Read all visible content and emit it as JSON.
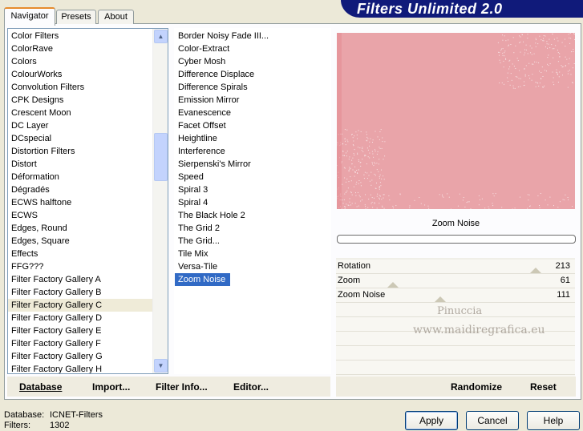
{
  "title": "Filters Unlimited 2.0",
  "tabs": [
    {
      "label": "Navigator"
    },
    {
      "label": "Presets"
    },
    {
      "label": "About"
    }
  ],
  "categories": [
    "Color Filters",
    "ColorRave",
    "Colors",
    "ColourWorks",
    "Convolution Filters",
    "CPK Designs",
    "Crescent Moon",
    "DC Layer",
    "DCspecial",
    "Distortion Filters",
    "Distort",
    "Déformation",
    "Dégradés",
    "ECWS halftone",
    "ECWS",
    "Edges, Round",
    "Edges, Square",
    "Effects",
    "FFG???",
    "Filter Factory Gallery A",
    "Filter Factory Gallery B",
    "Filter Factory Gallery C",
    "Filter Factory Gallery D",
    "Filter Factory Gallery E",
    "Filter Factory Gallery F",
    "Filter Factory Gallery G",
    "Filter Factory Gallery H"
  ],
  "selected_category": "Filter Factory Gallery C",
  "filters": [
    "Border Noisy Fade III...",
    "Color-Extract",
    "Cyber Mosh",
    "Difference Displace",
    "Difference Spirals",
    "Emission Mirror",
    "Evanescence",
    "Facet Offset",
    "Heightline",
    "Interference",
    "Sierpenski's Mirror",
    "Speed",
    "Spiral 3",
    "Spiral 4",
    "The Black Hole 2",
    "The Grid 2",
    "The Grid...",
    "Tile Mix",
    "Versa-Tile",
    "Zoom Noise"
  ],
  "selected_filter": "Zoom Noise",
  "preview": {
    "color": "#e9a4a9"
  },
  "filter_name": "Zoom Noise",
  "params": [
    {
      "name": "Rotation",
      "value": "213",
      "level": 0.835
    },
    {
      "name": "Zoom",
      "value": "61",
      "level": 0.239
    },
    {
      "name": "Zoom Noise",
      "value": "111",
      "level": 0.435
    }
  ],
  "watermark": {
    "line1": "Pinuccia",
    "line2": "www.maidiregrafica.eu"
  },
  "left_buttons": {
    "database": "Database",
    "import": "Import...",
    "filter_info": "Filter Info...",
    "editor": "Editor..."
  },
  "right_buttons": {
    "randomize": "Randomize",
    "reset": "Reset"
  },
  "status": {
    "database_label": "Database:",
    "database_value": "ICNET-Filters",
    "filters_label": "Filters:",
    "filters_value": "1302"
  },
  "dialog_buttons": {
    "apply": "Apply",
    "cancel": "Cancel",
    "help": "Help"
  },
  "accent_color": "#316ac5",
  "banner_color": "#101a7a"
}
